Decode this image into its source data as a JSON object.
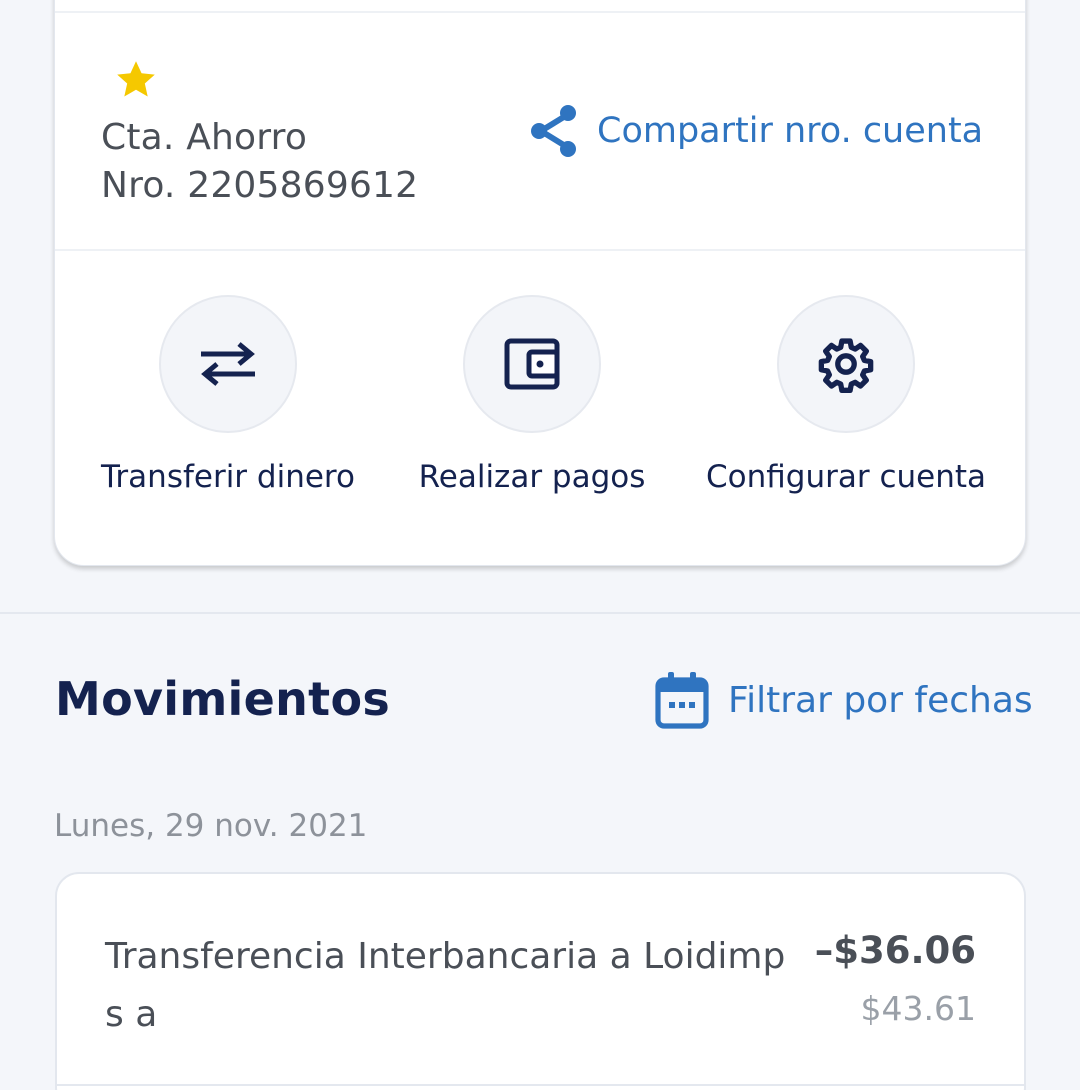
{
  "account": {
    "type_label": "Cta. Ahorro",
    "number_label": "Nro. 2205869612",
    "favorite_icon": "star-icon",
    "share_label": "Compartir nro. cuenta",
    "share_icon": "share-icon"
  },
  "actions": [
    {
      "label": "Transferir dinero",
      "icon": "transfer-arrows-icon"
    },
    {
      "label": "Realizar pagos",
      "icon": "wallet-icon"
    },
    {
      "label": "Configurar cuenta",
      "icon": "gear-icon"
    }
  ],
  "movements": {
    "title": "Movimientos",
    "filter_label": "Filtrar por fechas",
    "filter_icon": "calendar-icon",
    "groups": [
      {
        "date": "Lunes, 29 nov. 2021",
        "transactions": [
          {
            "description": "Transferencia Interbancaria a Loidimp s a",
            "amount": "–$36.06",
            "balance": "$43.61"
          }
        ]
      }
    ]
  },
  "colors": {
    "primary_dark": "#14224f",
    "link_blue": "#2f74c0",
    "star_yellow": "#f5c800",
    "background": "#f4f6fa"
  }
}
